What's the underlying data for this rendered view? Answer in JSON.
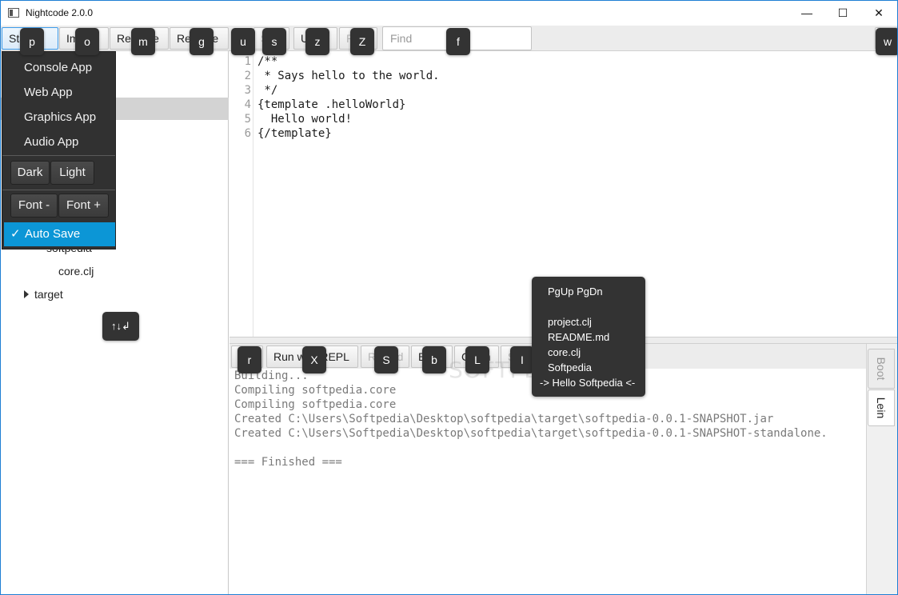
{
  "window": {
    "title": "Nightcode 2.0.0",
    "minimize_glyph": "—",
    "maximize_glyph": "☐",
    "close_glyph": "✕"
  },
  "toolbar": {
    "start": "Start",
    "import": "Import",
    "rename": "Rename",
    "remove": "Remove",
    "save": "Save",
    "undo": "Undo",
    "redo": "Redo",
    "find_placeholder": "Find"
  },
  "start_menu": {
    "items": [
      "Console App",
      "Web App",
      "Graphics App",
      "Audio App"
    ],
    "theme_dark": "Dark",
    "theme_light": "Light",
    "font_minus": "Font -",
    "font_plus": "Font +",
    "auto_save_check": "✓",
    "auto_save": "Auto Save"
  },
  "file_tree": {
    "items": [
      "softpedia",
      "core.clj",
      "target"
    ]
  },
  "editor": {
    "line_numbers": [
      "1",
      "2",
      "3",
      "4",
      "5",
      "6"
    ],
    "lines": [
      "/**",
      " * Says hello to the world.",
      " */",
      "{template .helloWorld}",
      "  Hello world!",
      "{/template}"
    ]
  },
  "build_toolbar": {
    "run": "Run",
    "run_with_repl": "Run with REPL",
    "reload": "Reload",
    "build": "Build",
    "clean": "Clean",
    "stop": "Stop"
  },
  "console": {
    "lines": [
      "Building...",
      "Compiling softpedia.core",
      "Compiling softpedia.core",
      "Created C:\\Users\\Softpedia\\Desktop\\softpedia\\target\\softpedia-0.0.1-SNAPSHOT.jar",
      "Created C:\\Users\\Softpedia\\Desktop\\softpedia\\target\\softpedia-0.0.1-SNAPSHOT-standalone.",
      "",
      "=== Finished ==="
    ]
  },
  "side_tabs": {
    "boot": "Boot",
    "lein": "Lein"
  },
  "hints": {
    "start": "p",
    "import": "o",
    "rename": "m",
    "remove": "g",
    "up": "u",
    "save": "s",
    "undo": "z",
    "redo": "Z",
    "find": "f",
    "wrap": "w",
    "run": "r",
    "run_with_repl": "X",
    "reload": "S",
    "build": "b",
    "clean": "L",
    "stop": "I",
    "tree_nav": "↑↓↲"
  },
  "nav_popup": {
    "keys": "PgUp PgDn",
    "entries": [
      "project.clj",
      "README.md",
      "core.clj",
      "Softpedia",
      "-> Hello Softpedia <-"
    ]
  },
  "watermark": "SOFTPEDIA"
}
